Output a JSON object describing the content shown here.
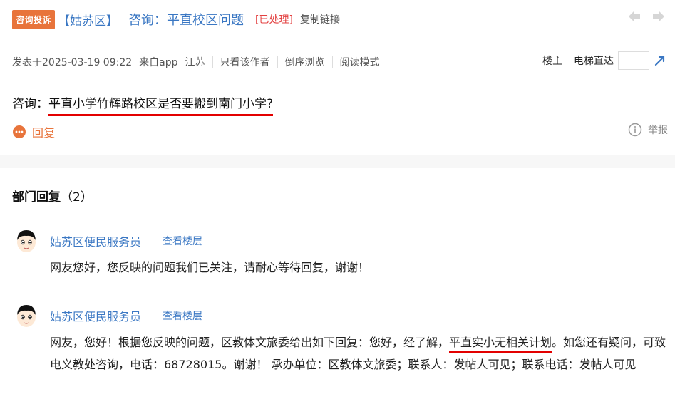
{
  "header": {
    "tag": "咨询投诉",
    "district": "【姑苏区】",
    "title": "咨询：平直校区问题",
    "status": "[已处理]",
    "copy_link": "复制链接"
  },
  "meta": {
    "posted": "发表于2025-03-19 09:22",
    "source": "来自app",
    "region": "江苏",
    "only_author": "只看该作者",
    "reverse": "倒序浏览",
    "read_mode": "阅读模式",
    "louzhu": "楼主",
    "elevator": "电梯直达",
    "floor_value": ""
  },
  "question": {
    "prefix": "咨询：",
    "text": "平直小学竹辉路校区是否要搬到南门小学?"
  },
  "actions": {
    "reply": "回复",
    "report": "举报"
  },
  "dept": {
    "title": "部门回复",
    "count": "（2）"
  },
  "replies": [
    {
      "name": "姑苏区便民服务员",
      "view": "查看楼层",
      "body": "网友您好，您反映的问题我们已关注，请耐心等待回复，谢谢！"
    },
    {
      "name": "姑苏区便民服务员",
      "view": "查看楼层",
      "body_a": "网友，您好！根据您反映的问题，区教体文旅委给出如下回复：您好，经了解，",
      "body_hl": "平直实小无相关计划",
      "body_b": "。如您还有疑问，可致电义教处咨询，电话：68728015。谢谢！ 承办单位：区教体文旅委；联系人：发帖人可见；联系电话：发帖人可见"
    }
  ],
  "colors": {
    "accent_orange": "#e8743b",
    "link_blue": "#3a77c3",
    "status_red": "#e34040",
    "underline_red": "#e30000"
  }
}
